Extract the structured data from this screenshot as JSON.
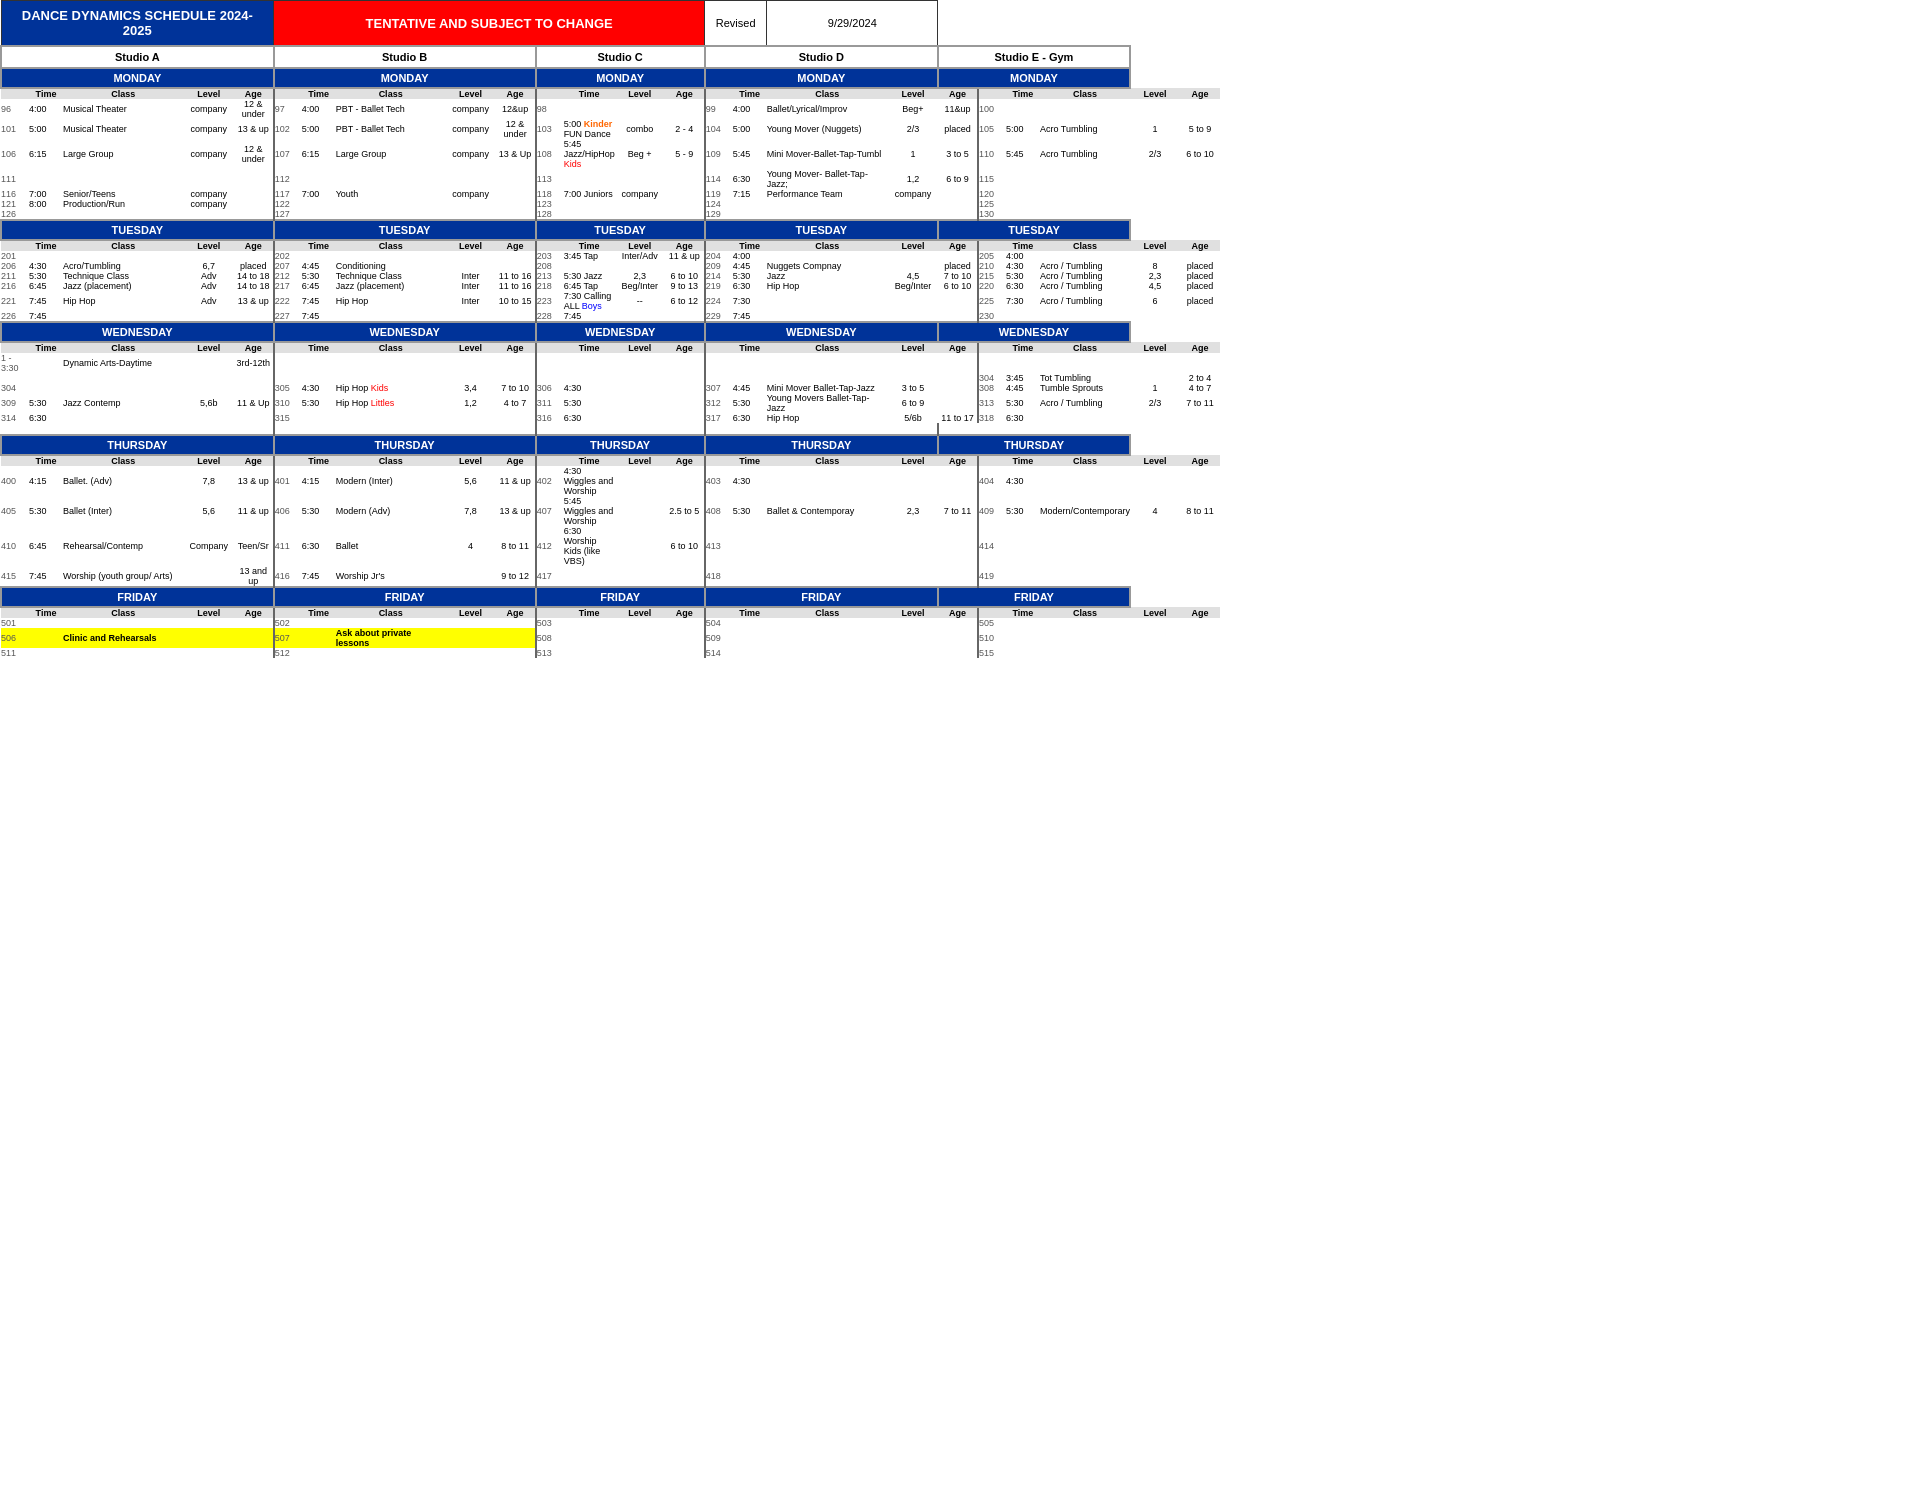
{
  "header": {
    "title": "DANCE DYNAMICS SCHEDULE 2024-2025",
    "tentative": "TENTATIVE AND SUBJECT TO CHANGE",
    "revised_label": "Revised",
    "revised_date": "9/29/2024"
  },
  "studios": [
    "Studio A",
    "Studio B",
    "Studio C",
    "Studio D",
    "Studio E - Gym"
  ],
  "days": [
    "MONDAY",
    "TUESDAY",
    "WEDNESDAY",
    "THURSDAY",
    "FRIDAY"
  ],
  "col_headers": [
    "Time",
    "Class",
    "Level",
    "Age"
  ]
}
